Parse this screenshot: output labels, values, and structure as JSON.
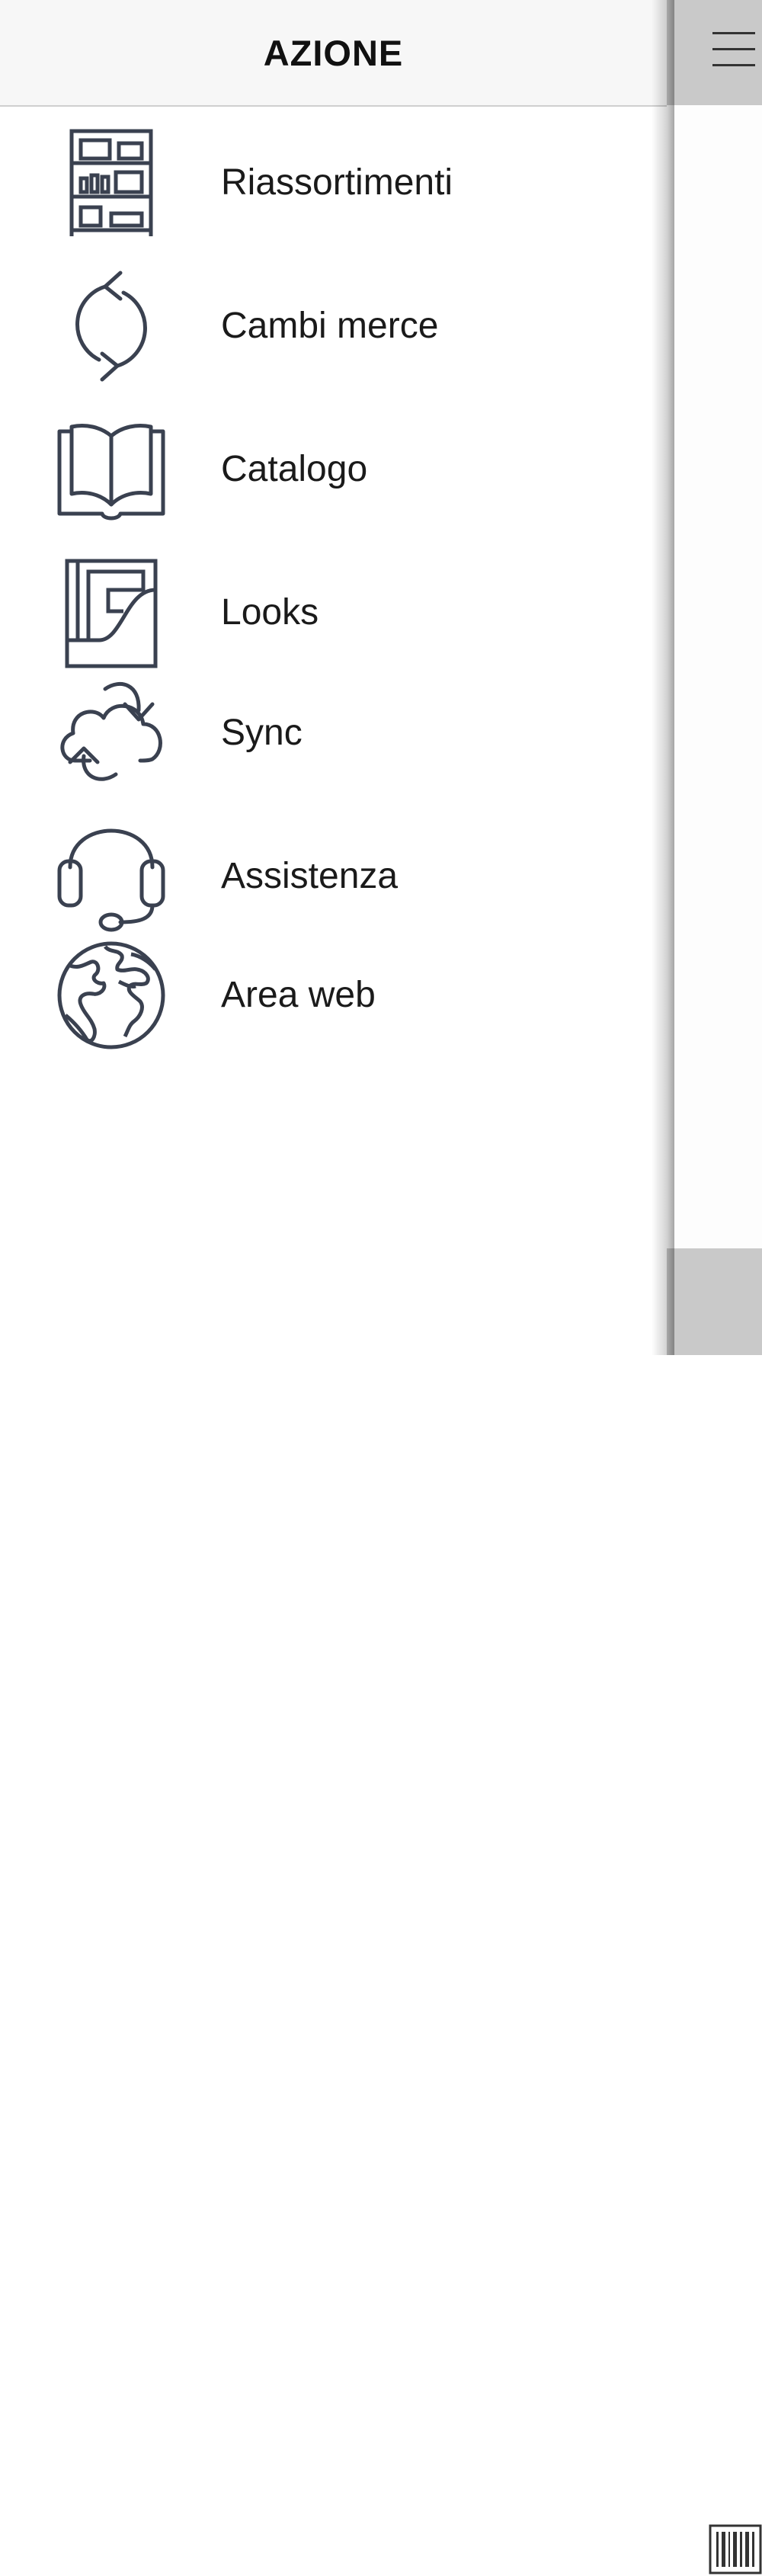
{
  "drawer": {
    "title": "AZIONE",
    "items": [
      {
        "label": "Riassortimenti",
        "icon": "shelf-icon"
      },
      {
        "label": "Cambi merce",
        "icon": "refresh-icon"
      },
      {
        "label": "Catalogo",
        "icon": "book-icon"
      },
      {
        "label": "Looks",
        "icon": "looks-icon"
      },
      {
        "label": "Sync",
        "icon": "cloud-sync-icon"
      },
      {
        "label": "Assistenza",
        "icon": "headset-icon"
      },
      {
        "label": "Area web",
        "icon": "globe-icon"
      }
    ]
  },
  "colors": {
    "icon_stroke": "#3a4150",
    "header_bg": "#f7f7f7",
    "main_bar_bg": "#c9c9c9"
  }
}
